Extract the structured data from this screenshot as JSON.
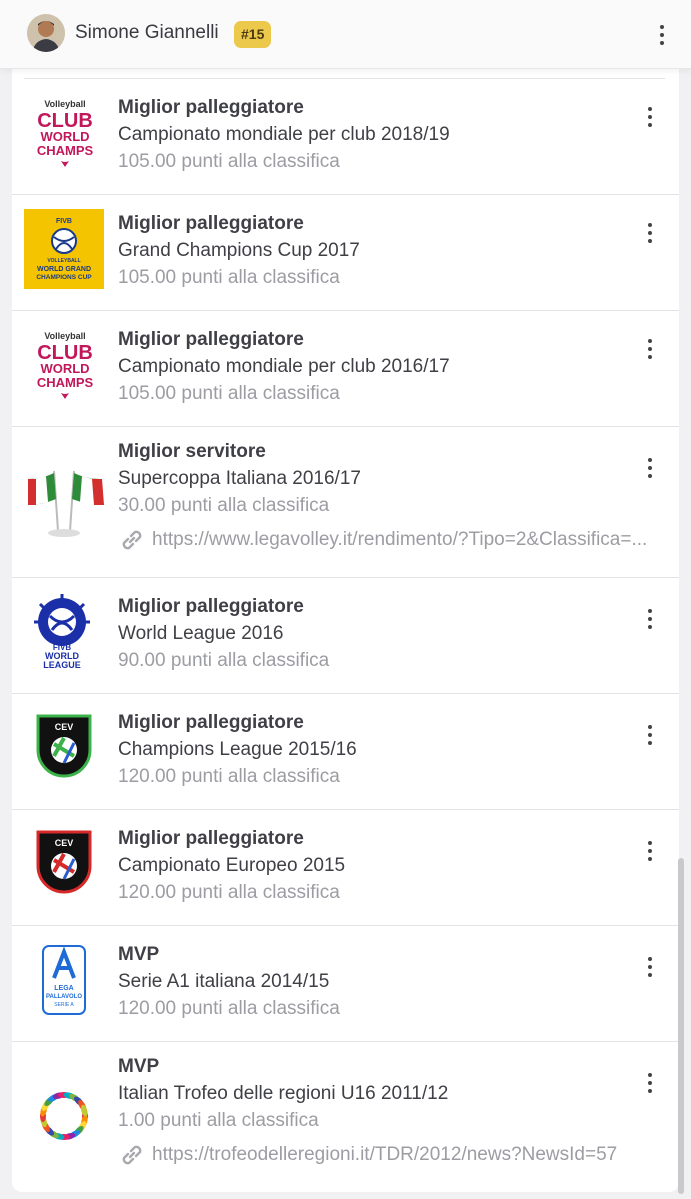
{
  "header": {
    "player_name": "Simone Giannelli",
    "rank": "#15"
  },
  "awards": [
    {
      "title": "Miglior palleggiatore",
      "event": "Campionato mondiale per club 2018/19",
      "points": "105.00 punti alla classifica",
      "logo": "club-world-champs-logo",
      "logo_text": [
        "Volleyball",
        "CLUB",
        "WORLD",
        "CHAMPS"
      ]
    },
    {
      "title": "Miglior palleggiatore",
      "event": "Grand Champions Cup 2017",
      "points": "105.00 punti alla classifica",
      "logo": "world-grand-champions-cup-logo",
      "logo_text": [
        "FIVB",
        "VOLLEYBALL",
        "WORLD GRAND",
        "CHAMPIONS CUP"
      ]
    },
    {
      "title": "Miglior palleggiatore",
      "event": "Campionato mondiale per club 2016/17",
      "points": "105.00 punti alla classifica",
      "logo": "club-world-champs-logo",
      "logo_text": [
        "Volleyball",
        "CLUB",
        "WORLD",
        "CHAMPS"
      ]
    },
    {
      "title": "Miglior servitore",
      "event": "Supercoppa Italiana 2016/17",
      "points": "30.00 punti alla classifica",
      "logo": "italian-flags-logo",
      "link": "https://www.legavolley.it/rendimento/?Tipo=2&Classifica=..."
    },
    {
      "title": "Miglior palleggiatore",
      "event": "World League 2016",
      "points": "90.00 punti alla classifica",
      "logo": "fivb-world-league-logo",
      "logo_text": [
        "FIVB",
        "WORLD",
        "LEAGUE"
      ]
    },
    {
      "title": "Miglior palleggiatore",
      "event": "Champions League 2015/16",
      "points": "120.00 punti alla classifica",
      "logo": "cev-champions-league-logo",
      "logo_text": [
        "CEV"
      ]
    },
    {
      "title": "Miglior palleggiatore",
      "event": "Campionato Europeo 2015",
      "points": "120.00 punti alla classifica",
      "logo": "cev-eurovolley-logo",
      "logo_text": [
        "CEV"
      ]
    },
    {
      "title": "MVP",
      "event": "Serie A1 italiana 2014/15",
      "points": "120.00 punti alla classifica",
      "logo": "lega-pallavolo-logo",
      "logo_text": [
        "LEGA",
        "PALLAVOLO",
        "SERIE A"
      ]
    },
    {
      "title": "MVP",
      "event": "Italian Trofeo delle regioni U16 2011/12",
      "points": "1.00 punti alla classifica",
      "logo": "trofeo-regioni-logo",
      "link": "https://trofeodelleregioni.it/TDR/2012/news?NewsId=57"
    }
  ],
  "colors": {
    "rank_badge": "#ecc84b",
    "club_champs": "#c2185b",
    "fivb_yellow": "#f5c400",
    "world_league_blue": "#1a2fa8"
  }
}
